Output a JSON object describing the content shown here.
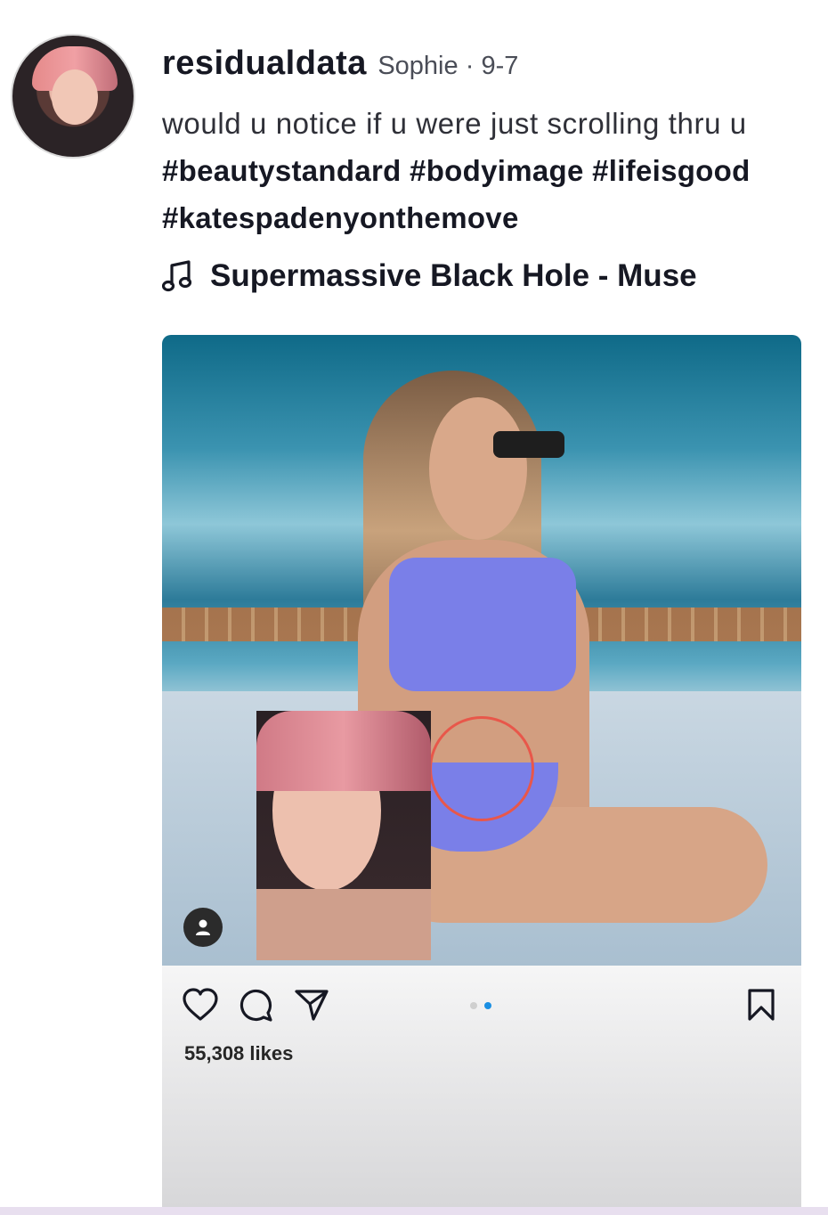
{
  "author": {
    "username": "residualdata",
    "display_name": "Sophie",
    "separator": "·",
    "date": "9-7"
  },
  "caption": {
    "text": "would u notice if u were just scrolling thru u",
    "hashtags_line1": "#beautystandard #bodyimage #lifeisgood",
    "hashtags_line2": "#katespadenyonthemove"
  },
  "music": {
    "icon": "music-note-icon",
    "title": "Supermassive Black Hole - Muse"
  },
  "embedded_post": {
    "likes": "55,308 likes",
    "carousel": {
      "total": 2,
      "active_index": 1
    },
    "colors": {
      "active_dot": "#1a8fe3",
      "inactive_dot": "#cfcfcf",
      "annotation_circle": "#e8574a"
    },
    "icons": [
      "heart-icon",
      "comment-icon",
      "share-icon",
      "bookmark-icon",
      "user-tag-icon"
    ]
  }
}
